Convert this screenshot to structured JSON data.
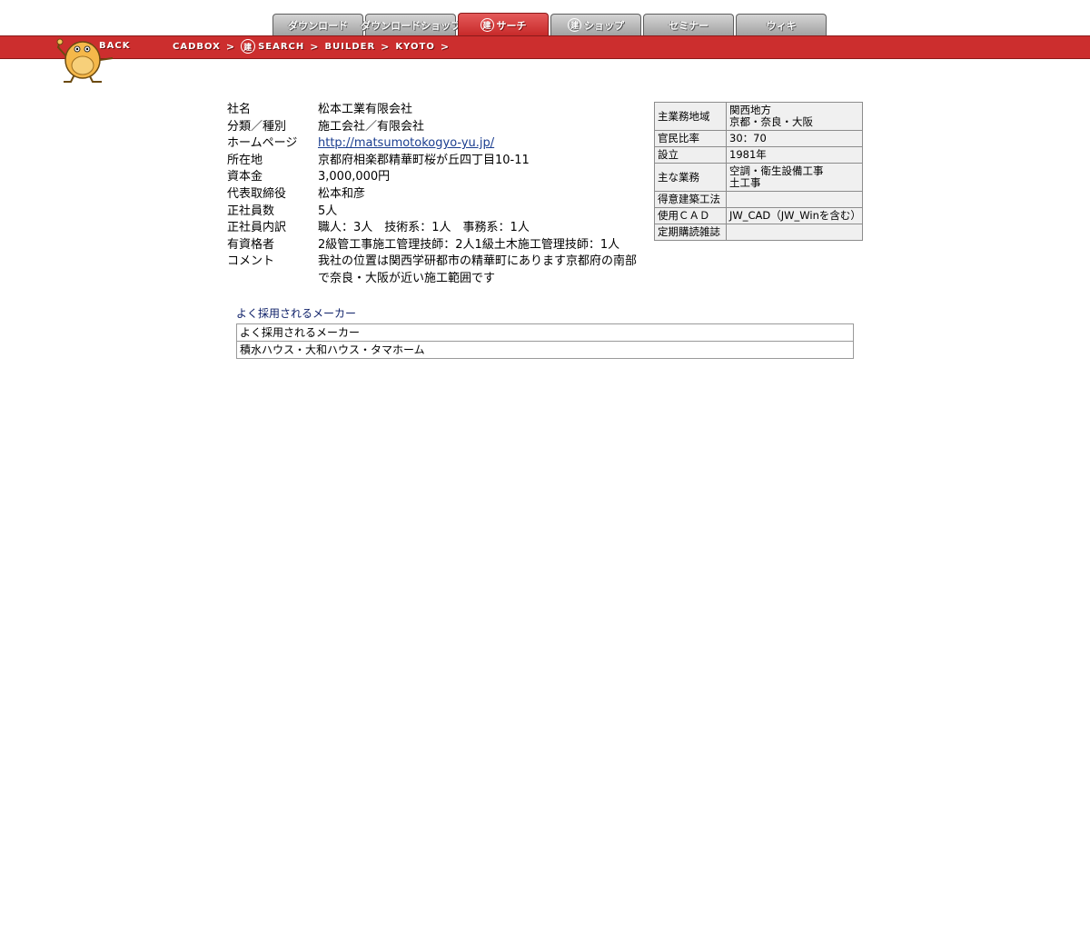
{
  "tabs": [
    {
      "label": "ダウンロード",
      "active": false
    },
    {
      "label": "ダウンロードショップ",
      "active": false
    },
    {
      "label": "サーチ",
      "mark": "建",
      "active": true
    },
    {
      "label": "ショップ",
      "mark": "建",
      "active": false
    },
    {
      "label": "セミナー",
      "active": false
    },
    {
      "label": "ウィキ",
      "active": false
    }
  ],
  "nav": {
    "back": "BACK",
    "crumbs": [
      {
        "label": "CADBOX"
      },
      {
        "label": "SEARCH",
        "mark": "建"
      },
      {
        "label": "BUILDER"
      },
      {
        "label": "KYOTO"
      }
    ],
    "separator": ">"
  },
  "company": {
    "rows": [
      {
        "label": "社名",
        "value": "松本工業有限会社"
      },
      {
        "label": "分類／種別",
        "value": "施工会社／有限会社"
      },
      {
        "label": "ホームページ",
        "value": "http://matsumotokogyo-yu.jp/",
        "link": true
      },
      {
        "label": "所在地",
        "value": "京都府相楽郡精華町桜が丘四丁目10-11"
      },
      {
        "label": "資本金",
        "value": "3,000,000円"
      },
      {
        "label": "代表取締役",
        "value": "松本和彦"
      },
      {
        "label": "正社員数",
        "value": "5人"
      },
      {
        "label": "正社員内訳",
        "value": "職人：3人　技術系：1人　事務系：1人"
      },
      {
        "label": "有資格者",
        "value": "2級管工事施工管理技師：2人1級土木施工管理技師：1人"
      },
      {
        "label": "コメント",
        "value": "我社の位置は関西学研都市の精華町にあります京都府の南部で奈良・大阪が近い施工範囲です"
      }
    ]
  },
  "side": {
    "rows": [
      {
        "label": "主業務地域",
        "value": [
          "関西地方",
          "京都・奈良・大阪"
        ]
      },
      {
        "label": "官民比率",
        "value": [
          "30：70"
        ]
      },
      {
        "label": "設立",
        "value": [
          "1981年"
        ]
      },
      {
        "label": "主な業務",
        "value": [
          "空調・衛生設備工事",
          "土工事"
        ]
      },
      {
        "label": "得意建築工法",
        "value": [
          ""
        ]
      },
      {
        "label": "使用ＣＡＤ",
        "value": [
          "JW_CAD（JW_Winを含む）"
        ]
      },
      {
        "label": "定期購読雑誌",
        "value": [
          ""
        ]
      }
    ]
  },
  "makers": {
    "title": "よく採用されるメーカー",
    "header": "よく採用されるメーカー",
    "value": "積水ハウス・大和ハウス・タマホーム"
  },
  "colors": {
    "bar_red": "#cc2e2e",
    "tab_gray": "#b8b8b8",
    "link": "#1a3d8f"
  }
}
